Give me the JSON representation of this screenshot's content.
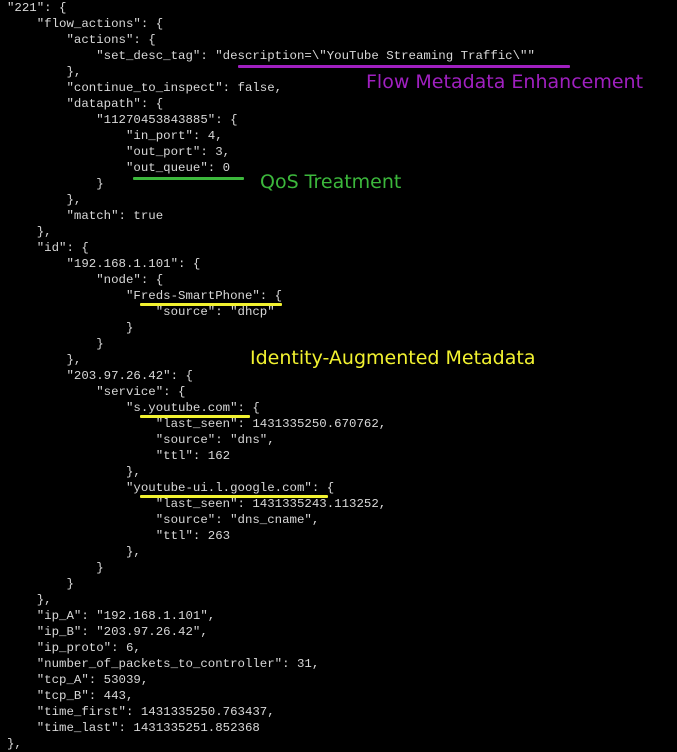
{
  "colors": {
    "background": "#000000",
    "text": "#d8d8d8",
    "flow_metadata": "#a020c0",
    "qos": "#3cb83c",
    "identity": "#f2f230"
  },
  "lines": [
    "\"221\": {",
    "    \"flow_actions\": {",
    "        \"actions\": {",
    "            \"set_desc_tag\": \"description=\\\"YouTube Streaming Traffic\\\"\"",
    "        },",
    "        \"continue_to_inspect\": false,",
    "        \"datapath\": {",
    "            \"11270453843885\": {",
    "                \"in_port\": 4,",
    "                \"out_port\": 3,",
    "                \"out_queue\": 0",
    "            }",
    "        },",
    "        \"match\": true",
    "    },",
    "    \"id\": {",
    "        \"192.168.1.101\": {",
    "            \"node\": {",
    "                \"Freds-SmartPhone\": {",
    "                    \"source\": \"dhcp\"",
    "                }",
    "            }",
    "        },",
    "        \"203.97.26.42\": {",
    "            \"service\": {",
    "                \"s.youtube.com\": {",
    "                    \"last_seen\": 1431335250.670762,",
    "                    \"source\": \"dns\",",
    "                    \"ttl\": 162",
    "                },",
    "                \"youtube-ui.l.google.com\": {",
    "                    \"last_seen\": 1431335243.113252,",
    "                    \"source\": \"dns_cname\",",
    "                    \"ttl\": 263",
    "                },",
    "            }",
    "        }",
    "    },",
    "    \"ip_A\": \"192.168.1.101\",",
    "    \"ip_B\": \"203.97.26.42\",",
    "    \"ip_proto\": 6,",
    "    \"number_of_packets_to_controller\": 31,",
    "    \"tcp_A\": 53039,",
    "    \"tcp_B\": 443,",
    "    \"time_first\": 1431335250.763437,",
    "    \"time_last\": 1431335251.852368",
    "},"
  ],
  "annotations": {
    "flow_metadata": "Flow Metadata Enhancement",
    "qos": "QoS Treatment",
    "identity": "Identity-Augmented Metadata"
  }
}
